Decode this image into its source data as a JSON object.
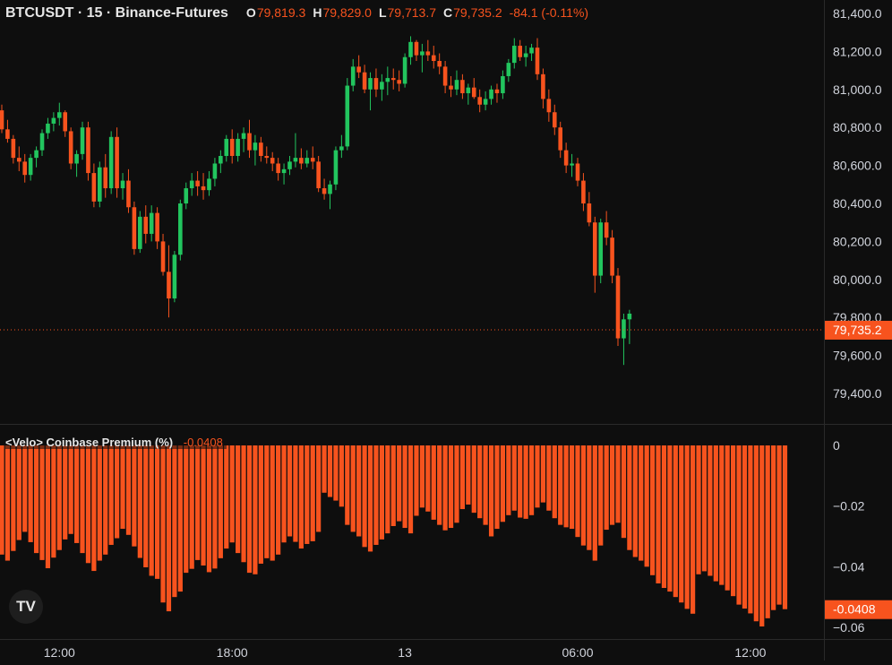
{
  "header": {
    "symbol": "BTCUSDT · 15 · Binance-Futures",
    "open_label": "O",
    "open": "79,819.3",
    "high_label": "H",
    "high": "79,829.0",
    "low_label": "L",
    "low": "79,713.7",
    "close_label": "C",
    "close": "79,735.2",
    "change": "-84.1 (-0.11%)"
  },
  "indicator": {
    "title": "<Velo> Coinbase Premium (%)",
    "value": "-0.0408"
  },
  "colors": {
    "background": "#0e0e0e",
    "up": "#22c55e",
    "down": "#f7531e",
    "price_badge": "#f7531e",
    "text": "#d1d4dc"
  },
  "logo": {
    "text": "TV",
    "icon": "tradingview-logo-icon"
  },
  "chart_data": [
    {
      "type": "candlestick",
      "title": "BTCUSDT · 15 · Binance-Futures",
      "y_ticks": [
        "81,400.0",
        "81,200.0",
        "81,000.0",
        "80,800.0",
        "80,600.0",
        "80,400.0",
        "80,200.0",
        "80,000.0",
        "79,800.0",
        "79,600.0",
        "79,400.0"
      ],
      "ylim": [
        79300,
        81450
      ],
      "last_price": 79735.2,
      "last_price_label": "79,735.2",
      "x_ticks": [
        {
          "label": "12:00",
          "index": 10
        },
        {
          "label": "18:00",
          "index": 40
        },
        {
          "label": "13",
          "index": 70
        },
        {
          "label": "06:00",
          "index": 100
        },
        {
          "label": "12:00",
          "index": 130
        }
      ],
      "ohlc": [
        [
          80890,
          80920,
          80770,
          80790
        ],
        [
          80790,
          80840,
          80720,
          80740
        ],
        [
          80740,
          80760,
          80610,
          80640
        ],
        [
          80640,
          80700,
          80570,
          80620
        ],
        [
          80620,
          80660,
          80510,
          80550
        ],
        [
          80550,
          80660,
          80520,
          80640
        ],
        [
          80640,
          80700,
          80590,
          80680
        ],
        [
          80680,
          80790,
          80650,
          80770
        ],
        [
          80770,
          80850,
          80740,
          80820
        ],
        [
          80820,
          80880,
          80780,
          80850
        ],
        [
          80850,
          80930,
          80810,
          80880
        ],
        [
          80880,
          80890,
          80750,
          80780
        ],
        [
          80780,
          80800,
          80580,
          80610
        ],
        [
          80610,
          80680,
          80540,
          80660
        ],
        [
          80660,
          80830,
          80630,
          80800
        ],
        [
          80800,
          80830,
          80520,
          80560
        ],
        [
          80560,
          80610,
          80380,
          80410
        ],
        [
          80410,
          80620,
          80380,
          80590
        ],
        [
          80590,
          80660,
          80430,
          80480
        ],
        [
          80480,
          80780,
          80450,
          80750
        ],
        [
          80750,
          80800,
          80430,
          80480
        ],
        [
          80480,
          80560,
          80420,
          80520
        ],
        [
          80520,
          80580,
          80350,
          80380
        ],
        [
          80380,
          80410,
          80130,
          80160
        ],
        [
          80160,
          80360,
          80140,
          80330
        ],
        [
          80330,
          80390,
          80190,
          80240
        ],
        [
          80240,
          80390,
          80200,
          80350
        ],
        [
          80350,
          80380,
          80160,
          80200
        ],
        [
          80200,
          80240,
          80020,
          80040
        ],
        [
          80040,
          80180,
          79800,
          79900
        ],
        [
          79900,
          80150,
          79880,
          80130
        ],
        [
          80130,
          80420,
          80100,
          80400
        ],
        [
          80400,
          80510,
          80370,
          80480
        ],
        [
          80480,
          80560,
          80440,
          80520
        ],
        [
          80520,
          80570,
          80440,
          80490
        ],
        [
          80490,
          80560,
          80420,
          80470
        ],
        [
          80470,
          80570,
          80440,
          80530
        ],
        [
          80530,
          80640,
          80490,
          80610
        ],
        [
          80610,
          80680,
          80560,
          80650
        ],
        [
          80650,
          80760,
          80620,
          80740
        ],
        [
          80740,
          80790,
          80610,
          80650
        ],
        [
          80650,
          80770,
          80620,
          80740
        ],
        [
          80740,
          80800,
          80670,
          80770
        ],
        [
          80770,
          80840,
          80640,
          80680
        ],
        [
          80680,
          80760,
          80600,
          80720
        ],
        [
          80720,
          80750,
          80620,
          80650
        ],
        [
          80650,
          80700,
          80610,
          80640
        ],
        [
          80640,
          80670,
          80570,
          80610
        ],
        [
          80610,
          80640,
          80520,
          80560
        ],
        [
          80560,
          80610,
          80500,
          80580
        ],
        [
          80580,
          80650,
          80550,
          80620
        ],
        [
          80620,
          80770,
          80590,
          80640
        ],
        [
          80640,
          80690,
          80580,
          80610
        ],
        [
          80610,
          80680,
          80590,
          80640
        ],
        [
          80640,
          80700,
          80580,
          80620
        ],
        [
          80620,
          80650,
          80460,
          80480
        ],
        [
          80480,
          80530,
          80420,
          80450
        ],
        [
          80450,
          80520,
          80370,
          80500
        ],
        [
          80500,
          80700,
          80470,
          80680
        ],
        [
          80680,
          80760,
          80640,
          80700
        ],
        [
          80700,
          81060,
          80680,
          81020
        ],
        [
          81020,
          81160,
          80990,
          81120
        ],
        [
          81120,
          81180,
          81060,
          81090
        ],
        [
          81090,
          81130,
          80980,
          81000
        ],
        [
          81000,
          81090,
          80890,
          81060
        ],
        [
          81060,
          81110,
          80960,
          81000
        ],
        [
          81000,
          81080,
          80940,
          81040
        ],
        [
          81040,
          81120,
          80970,
          81060
        ],
        [
          81060,
          81110,
          81000,
          81050
        ],
        [
          81050,
          81100,
          80990,
          81030
        ],
        [
          81030,
          81190,
          81010,
          81170
        ],
        [
          81170,
          81280,
          81130,
          81250
        ],
        [
          81250,
          81260,
          81150,
          81180
        ],
        [
          81180,
          81240,
          81090,
          81200
        ],
        [
          81200,
          81260,
          81150,
          81180
        ],
        [
          81180,
          81230,
          81110,
          81150
        ],
        [
          81150,
          81190,
          81080,
          81120
        ],
        [
          81120,
          81150,
          80980,
          81020
        ],
        [
          81020,
          81070,
          80960,
          81000
        ],
        [
          81000,
          81100,
          80970,
          81050
        ],
        [
          81050,
          81080,
          80950,
          80980
        ],
        [
          80980,
          81030,
          80920,
          81010
        ],
        [
          81010,
          81060,
          80950,
          80960
        ],
        [
          80960,
          81000,
          80880,
          80920
        ],
        [
          80920,
          80990,
          80890,
          80950
        ],
        [
          80950,
          81020,
          80920,
          81000
        ],
        [
          81000,
          81030,
          80930,
          80980
        ],
        [
          80980,
          81100,
          80950,
          81070
        ],
        [
          81070,
          81160,
          81040,
          81140
        ],
        [
          81140,
          81270,
          81110,
          81230
        ],
        [
          81230,
          81260,
          81150,
          81170
        ],
        [
          81170,
          81230,
          81120,
          81190
        ],
        [
          81190,
          81240,
          81150,
          81220
        ],
        [
          81220,
          81270,
          81050,
          81080
        ],
        [
          81080,
          81110,
          80900,
          80950
        ],
        [
          80950,
          81000,
          80830,
          80880
        ],
        [
          80880,
          80920,
          80760,
          80800
        ],
        [
          80800,
          80830,
          80640,
          80680
        ],
        [
          80680,
          80720,
          80560,
          80600
        ],
        [
          80600,
          80660,
          80540,
          80610
        ],
        [
          80610,
          80640,
          80490,
          80520
        ],
        [
          80520,
          80560,
          80360,
          80400
        ],
        [
          80400,
          80460,
          80280,
          80300
        ],
        [
          80300,
          80330,
          79930,
          80020
        ],
        [
          80020,
          80320,
          79980,
          80300
        ],
        [
          80300,
          80360,
          80180,
          80220
        ],
        [
          80220,
          80260,
          79980,
          80020
        ],
        [
          80020,
          80060,
          79650,
          79690
        ],
        [
          79690,
          79820,
          79550,
          79790
        ],
        [
          79790,
          79840,
          79660,
          79820
        ]
      ]
    },
    {
      "type": "bar",
      "title": "<Velo> Coinbase Premium (%)",
      "y_ticks": [
        "0",
        "−0.02",
        "−0.04",
        "−0.06"
      ],
      "ylim": [
        -0.062,
        0.003
      ],
      "last_value_label": "-0.0408",
      "values": [
        -0.036,
        -0.038,
        -0.0348,
        -0.0312,
        -0.0285,
        -0.0319,
        -0.0355,
        -0.0378,
        -0.0405,
        -0.037,
        -0.0345,
        -0.031,
        -0.0292,
        -0.0322,
        -0.0355,
        -0.0388,
        -0.0414,
        -0.038,
        -0.036,
        -0.0328,
        -0.0306,
        -0.0275,
        -0.0295,
        -0.0333,
        -0.0371,
        -0.0402,
        -0.043,
        -0.044,
        -0.0518,
        -0.0547,
        -0.05,
        -0.0482,
        -0.042,
        -0.0407,
        -0.0378,
        -0.0396,
        -0.0418,
        -0.0406,
        -0.0372,
        -0.034,
        -0.032,
        -0.0355,
        -0.0385,
        -0.042,
        -0.0425,
        -0.039,
        -0.0372,
        -0.038,
        -0.036,
        -0.032,
        -0.03,
        -0.0318,
        -0.034,
        -0.0325,
        -0.0316,
        -0.0285,
        -0.0156,
        -0.017,
        -0.0182,
        -0.0202,
        -0.0262,
        -0.0285,
        -0.03,
        -0.0335,
        -0.035,
        -0.0328,
        -0.031,
        -0.029,
        -0.0266,
        -0.025,
        -0.0272,
        -0.029,
        -0.0232,
        -0.0205,
        -0.0218,
        -0.0245,
        -0.0262,
        -0.028,
        -0.0272,
        -0.0255,
        -0.021,
        -0.0195,
        -0.0222,
        -0.024,
        -0.0262,
        -0.03,
        -0.0275,
        -0.0252,
        -0.023,
        -0.0215,
        -0.0238,
        -0.0242,
        -0.023,
        -0.0205,
        -0.0188,
        -0.0215,
        -0.024,
        -0.0262,
        -0.027,
        -0.0275,
        -0.0302,
        -0.033,
        -0.0345,
        -0.038,
        -0.033,
        -0.0278,
        -0.0262,
        -0.0255,
        -0.0305,
        -0.0345,
        -0.0368,
        -0.038,
        -0.04,
        -0.0428,
        -0.0455,
        -0.047,
        -0.0482,
        -0.05,
        -0.0518,
        -0.0539,
        -0.0555,
        -0.0425,
        -0.0415,
        -0.043,
        -0.0448,
        -0.046,
        -0.0478,
        -0.0497,
        -0.0525,
        -0.0538,
        -0.0554,
        -0.058,
        -0.0597,
        -0.057,
        -0.0543,
        -0.0525,
        -0.054
      ]
    }
  ]
}
